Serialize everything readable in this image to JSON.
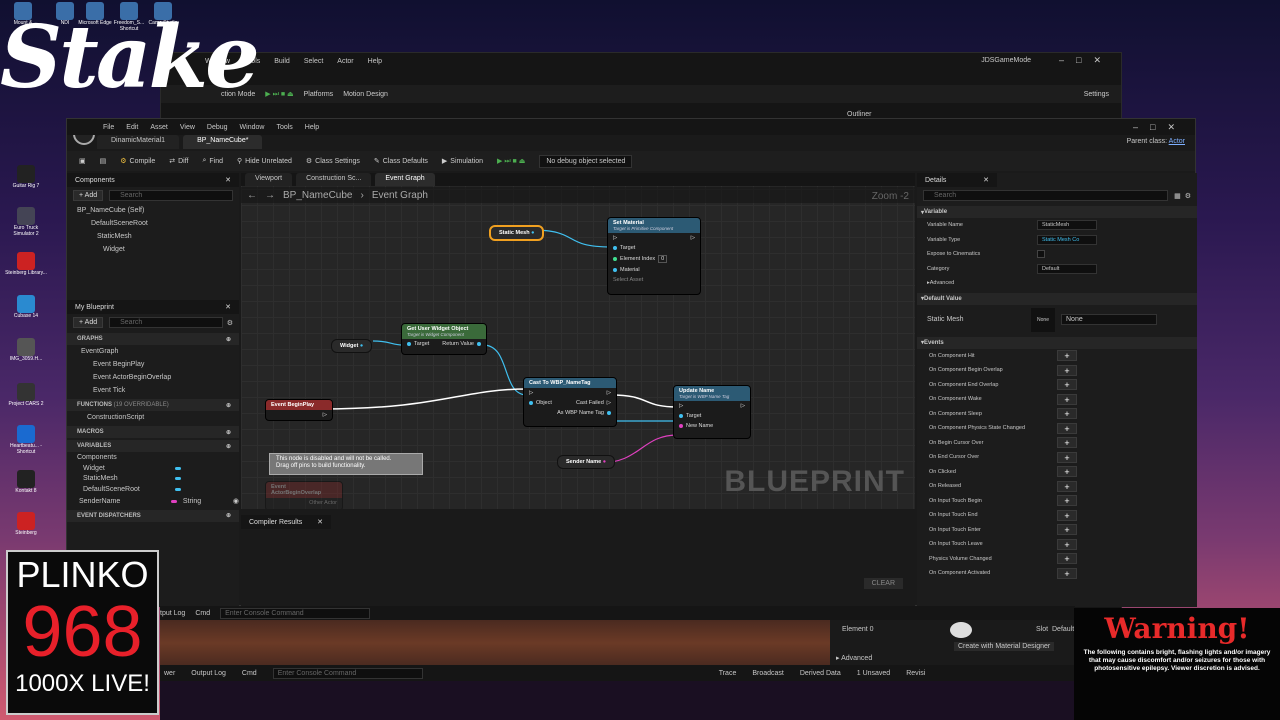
{
  "overlay": {
    "logo_text": "Stake",
    "plinko": {
      "title": "PLINKO",
      "number": "968",
      "subtitle": "1000X LIVE!"
    },
    "warning": {
      "title": "Warning!",
      "body": "The following contains bright, flashing lights and/or imagery that may cause discomfort and/or seizures for those with photosensitive epilepsy. Viewer discretion is advised."
    }
  },
  "desktop_icons": [
    {
      "label": "Mount &"
    },
    {
      "label": "NDI"
    },
    {
      "label": "Microsoft Edge"
    },
    {
      "label": "Freedom_S... Shortcut"
    },
    {
      "label": "Camo Studio"
    },
    {
      "label": "Guitar Rig 7"
    },
    {
      "label": "Euro Truck Simulator 2"
    },
    {
      "label": "Steinberg Library..."
    },
    {
      "label": "Cubase 14"
    },
    {
      "label": "IMG_3059.H..."
    },
    {
      "label": "Project CARS 2"
    },
    {
      "label": "Heartbeatu... - Shortcut"
    },
    {
      "label": "Kontakt 8"
    },
    {
      "label": "Steinberg"
    }
  ],
  "bg_window": {
    "menu": [
      "Window",
      "Tools",
      "Build",
      "Select",
      "Actor",
      "Help"
    ],
    "title": "JDSGameMode",
    "toolbar": [
      "ction Mode",
      "Platforms",
      "Motion Design",
      "Settings"
    ],
    "outliner": "Outliner"
  },
  "bp_window": {
    "menu": [
      "File",
      "Edit",
      "Asset",
      "View",
      "Debug",
      "Window",
      "Tools",
      "Help"
    ],
    "tabs": [
      {
        "label": "DinamicMaterial1"
      },
      {
        "label": "BP_NameCube*"
      }
    ],
    "parent_class_label": "Parent class:",
    "parent_class_value": "Actor",
    "toolbar": {
      "compile": "Compile",
      "diff": "Diff",
      "find": "Find",
      "hide_unrelated": "Hide Unrelated",
      "class_settings": "Class Settings",
      "class_defaults": "Class Defaults",
      "simulation": "Simulation",
      "debug_object": "No debug object selected"
    }
  },
  "components_panel": {
    "title": "Components",
    "add": "+ Add",
    "search_placeholder": "Search",
    "items": [
      "BP_NameCube (Self)",
      "DefaultSceneRoot",
      "StaticMesh",
      "Widget"
    ]
  },
  "my_blueprint": {
    "title": "My Blueprint",
    "add": "+ Add",
    "search_placeholder": "Search",
    "graphs_label": "GRAPHS",
    "graph_items": [
      "EventGraph",
      "Event BeginPlay",
      "Event ActorBeginOverlap",
      "Event Tick"
    ],
    "functions_label": "FUNCTIONS",
    "functions_count": "(19 OVERRIDABLE)",
    "function_items": [
      "ConstructionScript"
    ],
    "macros_label": "MACROS",
    "variables_label": "VARIABLES",
    "components_label": "Components",
    "variable_items": [
      "Widget",
      "StaticMesh",
      "DefaultSceneRoot"
    ],
    "sender_name": "SenderName",
    "sender_type": "String",
    "dispatchers_label": "EVENT DISPATCHERS"
  },
  "graph": {
    "tabs": [
      "Viewport",
      "Construction Sc...",
      "Event Graph"
    ],
    "breadcrumb_root": "BP_NameCube",
    "breadcrumb_leaf": "Event Graph",
    "zoom": "Zoom -2",
    "watermark": "BLUEPRINT",
    "nodes": {
      "static_mesh_var": "Static Mesh",
      "set_material": {
        "title": "Set Material",
        "sub": "Target is Primitive Component",
        "target": "Target",
        "element_index": "Element Index",
        "element_index_val": "0",
        "material": "Material",
        "material_val": "Select Asset"
      },
      "widget_var": "Widget",
      "get_user_widget": {
        "title": "Get User Widget Object",
        "sub": "Target is Widget Component",
        "target": "Target",
        "return": "Return Value"
      },
      "cast": {
        "title": "Cast To WBP_NameTag",
        "object": "Object",
        "cast_failed": "Cast Failed",
        "as": "As WBP Name Tag"
      },
      "update_name": {
        "title": "Update Name",
        "sub": "Target is WBP Name Tag",
        "target": "Target",
        "new_name": "New Name"
      },
      "begin_play": "Event BeginPlay",
      "sender_var": "Sender Name",
      "comment": "This node is disabled and will not be called.\nDrag off pins to build functionality.",
      "disabled_event": "Event ActorBeginOverlap",
      "other_actor": "Other Actor"
    }
  },
  "compiler": {
    "title": "Compiler Results",
    "clear": "CLEAR"
  },
  "details": {
    "title": "Details",
    "search_placeholder": "Search",
    "variable_section": "Variable",
    "var_name_label": "Variable Name",
    "var_name_val": "StaticMesh",
    "var_type_label": "Variable Type",
    "var_type_val": "Static Mesh Co",
    "expose_label": "Expose to Cinematics",
    "category_label": "Category",
    "category_val": "Default",
    "advanced": "Advanced",
    "default_section": "Default Value",
    "static_mesh_label": "Static Mesh",
    "static_mesh_thumb": "None",
    "static_mesh_val": "None",
    "events_section": "Events",
    "events": [
      "On Component Hit",
      "On Component Begin Overlap",
      "On Component End Overlap",
      "On Component Wake",
      "On Component Sleep",
      "On Component Physics State Changed",
      "On Begin Cursor Over",
      "On End Cursor Over",
      "On Clicked",
      "On Released",
      "On Input Touch Begin",
      "On Input Touch End",
      "On Input Touch Enter",
      "On Input Touch Leave",
      "Physics Volume Changed",
      "On Component Activated"
    ]
  },
  "bg_bottom": {
    "output_log_partial": "tput Log",
    "cmd": "Cmd",
    "console_placeholder": "Enter Console Command",
    "element0": "Element 0",
    "create_material": "Create with Material Designer",
    "advanced": "Advanced",
    "slot": "Slot",
    "slot_val": "Default",
    "status": [
      "Output Log",
      "Cmd",
      "Trace",
      "Broadcast",
      "Derived Data",
      "1 Unsaved",
      "Revisi"
    ],
    "wer": "wer"
  }
}
